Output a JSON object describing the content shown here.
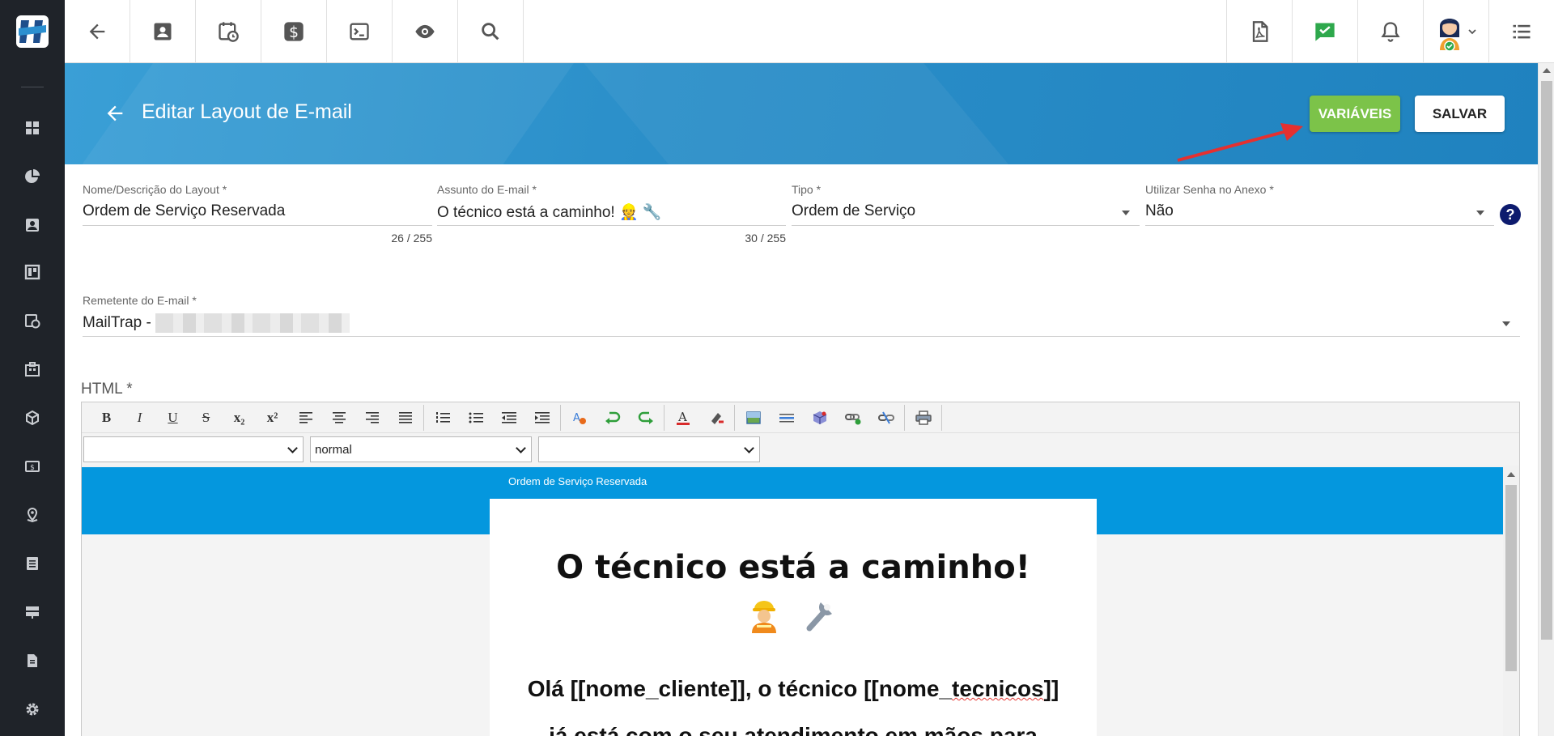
{
  "topbar": {
    "left_icons": [
      "back-arrow-icon",
      "contacts-icon",
      "calendar-clock-icon",
      "dollar-icon",
      "terminal-icon",
      "eye-icon",
      "search-icon"
    ],
    "right_icons": [
      "pdf-icon",
      "chat-check-icon",
      "bell-icon",
      "avatar-icon",
      "menu-list-icon"
    ]
  },
  "sidebar": {
    "items": [
      "dashboard-icon",
      "pie-chart-icon",
      "contact-card-icon",
      "kanban-icon",
      "calendar-clock-icon",
      "building-icon",
      "package-icon",
      "money-icon",
      "map-pin-icon",
      "list-icon",
      "server-icon",
      "document-icon",
      "gear-icon"
    ]
  },
  "header": {
    "title": "Editar Layout de E-mail",
    "variables_button": "VARIÁVEIS",
    "save_button": "SALVAR",
    "accent_color": "#7cc349"
  },
  "form": {
    "layout_name": {
      "label": "Nome/Descrição do Layout *",
      "value": "Ordem de Serviço Reservada",
      "counter": "26 / 255"
    },
    "subject": {
      "label": "Assunto do E-mail *",
      "value": "O técnico está a caminho! 👷 🔧",
      "counter": "30 / 255"
    },
    "type": {
      "label": "Tipo *",
      "value": "Ordem de Serviço"
    },
    "password": {
      "label": "Utilizar Senha no Anexo *",
      "value": "Não"
    },
    "sender": {
      "label": "Remetente do E-mail *",
      "value": "MailTrap -"
    },
    "help": "?"
  },
  "editor": {
    "label": "HTML *",
    "toolbar": [
      "B",
      "I",
      "U",
      "S",
      "x₂",
      "x²"
    ],
    "font_select": "",
    "size_select": "normal",
    "style_select": "",
    "preview": {
      "strip_text": "Ordem de Serviço Reservada",
      "title": "O técnico está a caminho!",
      "line1_a": "Olá [[nome_cliente]], o técnico [[nome_",
      "line1_b": "tecnicos",
      "line1_c": "]]",
      "line2": "já está com o seu atendimento em mãos para"
    }
  }
}
